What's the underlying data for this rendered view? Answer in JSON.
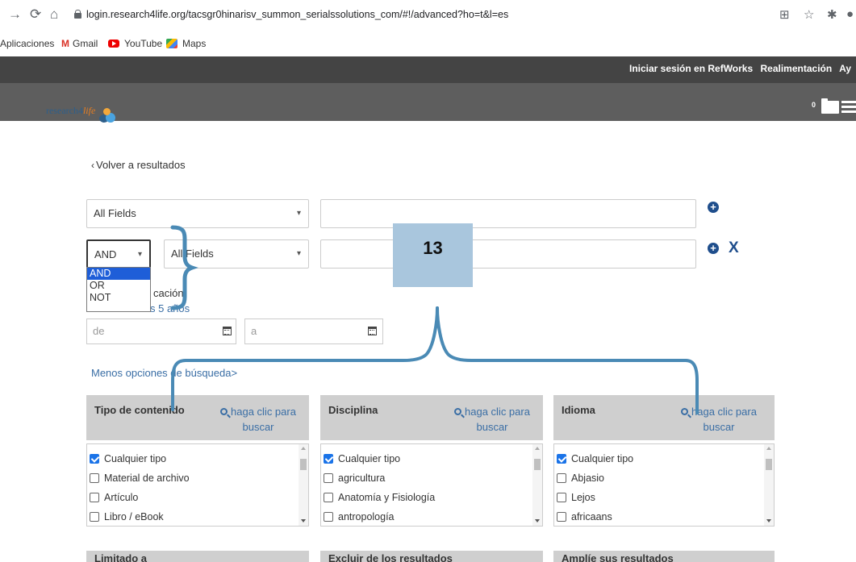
{
  "browser": {
    "url": "login.research4life.org/tacsgr0hinarisv_summon_serialssolutions_com/#!/advanced?ho=t&l=es",
    "bookmarks": [
      {
        "label": "Aplicaciones",
        "icon": "apps-icon"
      },
      {
        "label": "Gmail",
        "icon": "gmail-icon"
      },
      {
        "label": "YouTube",
        "icon": "youtube-icon"
      },
      {
        "label": "Maps",
        "icon": "maps-icon"
      }
    ]
  },
  "header": {
    "top_links": [
      "Iniciar sesión en RefWorks",
      "Realimentación",
      "Ay"
    ],
    "logo_text_prefix": "research4",
    "logo_text_suffix": "life",
    "folder_count": "0"
  },
  "search": {
    "back_link": "Volver a resultados",
    "row1": {
      "field": "All Fields"
    },
    "row2": {
      "operator": "AND",
      "field": "All Fields"
    },
    "operator_options": [
      "AND",
      "OR",
      "NOT"
    ],
    "publication_label": "Fecha de publicación",
    "publication_label_visible": "cación",
    "years_link": "Últimos 5 años",
    "years_link_visible": "s 5 años",
    "date_from_placeholder": "de",
    "date_to_placeholder": "a",
    "less_options": "Menos opciones de búsqueda>"
  },
  "facets": [
    {
      "title": "Tipo de contenido",
      "search_label": "haga clic para buscar",
      "search_line1": "haga clic para",
      "search_line2": "buscar",
      "items": [
        {
          "label": "Cualquier tipo",
          "checked": true
        },
        {
          "label": "Material de archivo",
          "checked": false
        },
        {
          "label": "Artículo",
          "checked": false
        },
        {
          "label": "Libro / eBook",
          "checked": false
        }
      ]
    },
    {
      "title": "Disciplina",
      "search_label": "haga clic para buscar",
      "search_line1": "haga clic para",
      "search_line2": "buscar",
      "items": [
        {
          "label": "Cualquier tipo",
          "checked": true
        },
        {
          "label": "agricultura",
          "checked": false
        },
        {
          "label": "Anatomía y Fisiología",
          "checked": false
        },
        {
          "label": "antropología",
          "checked": false
        }
      ]
    },
    {
      "title": "Idioma",
      "search_label": "haga clic para buscar",
      "search_line1": "haga clic para",
      "search_line2": "buscar",
      "items": [
        {
          "label": "Cualquier tipo",
          "checked": true
        },
        {
          "label": "Abjasio",
          "checked": false
        },
        {
          "label": "Lejos",
          "checked": false
        },
        {
          "label": "africaans",
          "checked": false
        }
      ]
    }
  ],
  "bottom_sections": [
    "Limitado a",
    "Excluir de los resultados",
    "Amplíe sus resultados"
  ],
  "annotation": {
    "label": "13",
    "color": "#a9c6dd",
    "line_color": "#4a8ab5"
  },
  "colors": {
    "link": "#3a6ea5",
    "icon_blue": "#1f4e8c",
    "dropdown_selected": "#1e5ed8",
    "facet_header": "#cfcfcf"
  }
}
